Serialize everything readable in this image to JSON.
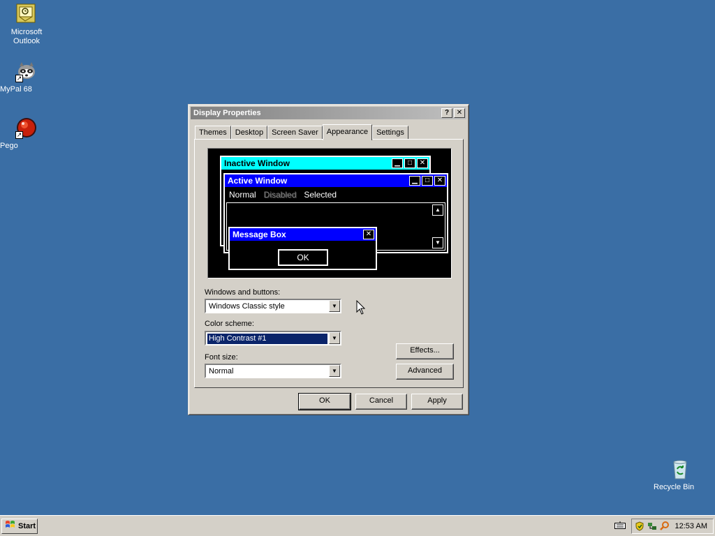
{
  "desktop": {
    "icons": [
      {
        "label": "Microsoft Outlook"
      },
      {
        "label": "MyPal 68"
      },
      {
        "label": "Pego"
      },
      {
        "label": "Recycle Bin"
      }
    ]
  },
  "window": {
    "title": "Display Properties",
    "help": "?",
    "close": "✕",
    "tabs": [
      "Themes",
      "Desktop",
      "Screen Saver",
      "Appearance",
      "Settings"
    ],
    "active_tab": "Appearance"
  },
  "preview": {
    "inactive_title": "Inactive Window",
    "active_title": "Active Window",
    "menu": {
      "normal": "Normal",
      "disabled": "Disabled",
      "selected": "Selected"
    },
    "message_title": "Message Box",
    "ok": "OK",
    "colors": {
      "inactive": "#00ffff",
      "active": "#0000ff",
      "background": "#000000"
    }
  },
  "form": {
    "windows_buttons_label": "Windows and buttons:",
    "windows_buttons_value": "Windows Classic style",
    "color_scheme_label": "Color scheme:",
    "color_scheme_value": "High Contrast #1",
    "font_size_label": "Font size:",
    "font_size_value": "Normal",
    "effects": "Effects...",
    "advanced": "Advanced"
  },
  "buttons": {
    "ok": "OK",
    "cancel": "Cancel",
    "apply": "Apply"
  },
  "taskbar": {
    "start": "Start",
    "clock": "12:53 AM"
  }
}
